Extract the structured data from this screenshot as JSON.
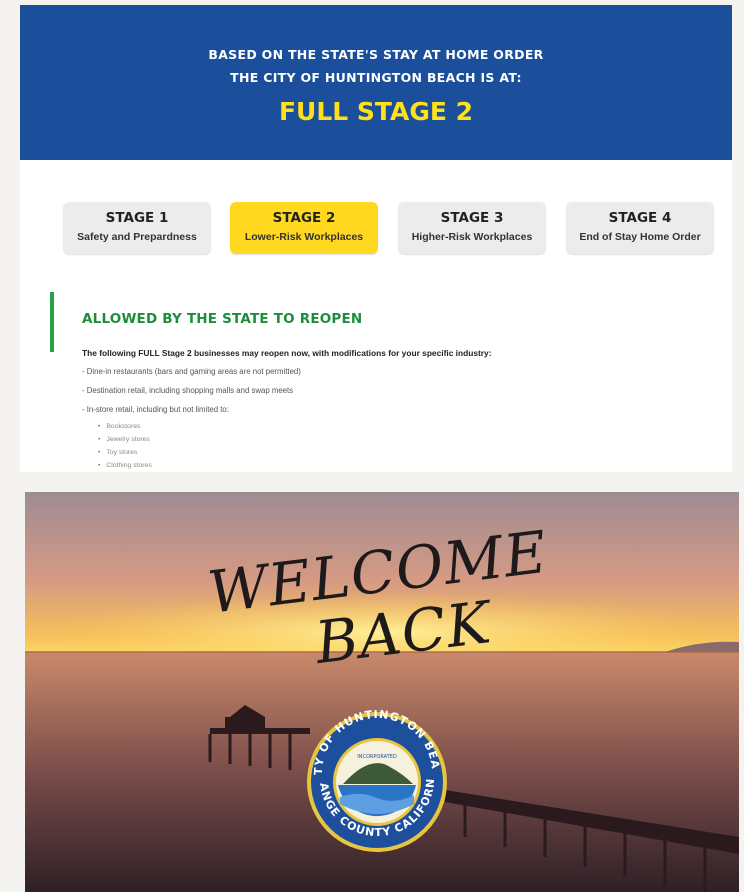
{
  "banner": {
    "line1": "BASED ON THE STATE'S STAY AT HOME ORDER",
    "line2": "THE CITY OF HUNTINGTON BEACH IS AT:",
    "current_stage": "FULL STAGE 2",
    "bg_color": "#1b4f9b",
    "accent_color": "#ffe11a"
  },
  "stages": [
    {
      "title": "STAGE 1",
      "subtitle": "Safety and Prepardness",
      "active": false
    },
    {
      "title": "STAGE 2",
      "subtitle": "Lower-Risk Workplaces",
      "active": true
    },
    {
      "title": "STAGE 3",
      "subtitle": "Higher-Risk Workplaces",
      "active": false
    },
    {
      "title": "STAGE 4",
      "subtitle": "End of Stay Home Order",
      "active": false
    }
  ],
  "allowed": {
    "heading": "ALLOWED BY THE STATE TO REOPEN",
    "heading_color": "#1c8d3a",
    "intro": "The following FULL Stage 2 businesses may reopen now, with modifications for your specific industry:",
    "items": [
      "- Dine-in restaurants (bars and gaming areas are not permitted)",
      "- Destination retail, including shopping malls and swap meets",
      "- In-store retail, including but not limited to:"
    ],
    "sub_items": [
      "Bookstores",
      "Jewelry stores",
      "Toy stores",
      "Clothing stores"
    ]
  },
  "photo": {
    "headline_1": "WELCOME",
    "headline_2": "BACK",
    "seal_top": "CITY OF HUNTINGTON BEACH",
    "seal_bottom": "ORANGE COUNTY CALIFORNIA",
    "seal_center": "INCORPORATED"
  }
}
